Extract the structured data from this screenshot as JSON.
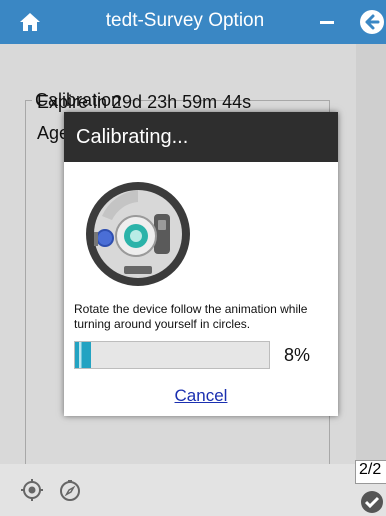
{
  "colors": {
    "titlebar": "#3a87c4",
    "dialog_title": "#2e2e2e",
    "progress": "#23a3c2",
    "link": "#1a2fb0"
  },
  "titlebar": {
    "title": "tedt-Survey Option",
    "home_icon": "home-icon",
    "minimize_icon": "minimize-icon",
    "back_icon": "back-arrow-icon"
  },
  "calibration": {
    "legend": "Calibration",
    "expire": "Expire in 29d 23h 59m 44s",
    "age_partial": "Age"
  },
  "page_indicator": "2/2",
  "footer": {
    "icons": [
      "gps-target-icon",
      "compass-icon",
      "checkmark-icon"
    ]
  },
  "dialog": {
    "title": "Calibrating...",
    "illustration": "device-rotation-icon",
    "instruction": "Rotate the device follow the animation while turning around yourself in circles.",
    "progress_percent": 8,
    "progress_label": "8%",
    "cancel_label": "Cancel"
  }
}
